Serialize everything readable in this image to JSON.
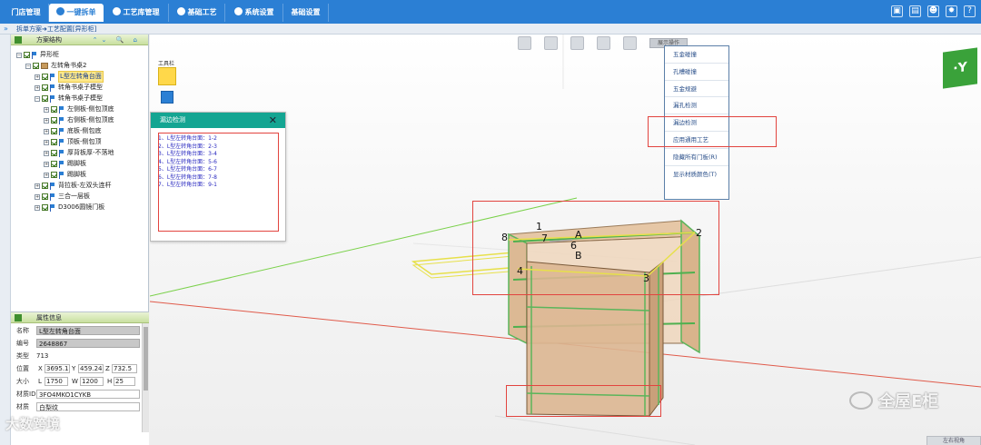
{
  "top_tabs": [
    {
      "label": "门店管理"
    },
    {
      "label": "一键拆单"
    },
    {
      "label": "工艺库管理"
    },
    {
      "label": "基础工艺"
    },
    {
      "label": "系统设置"
    },
    {
      "label": "基础设置"
    }
  ],
  "breadcrumb": {
    "arrow": "»",
    "text": "拆单方案➜工艺配置[异形柜]"
  },
  "scheme_panel": {
    "title": "方案结构",
    "tools": "⌃⌄ 🔍 ⌂",
    "tree": [
      {
        "label": "异形柜"
      },
      {
        "label": "左转角书桌2"
      },
      {
        "label": "L型左转角台面"
      },
      {
        "label": "转角书桌子模型"
      },
      {
        "label": "转角书桌子模型"
      },
      {
        "label": "左侧板-侧包顶底"
      },
      {
        "label": "右侧板-侧包顶底"
      },
      {
        "label": "底板-侧包底"
      },
      {
        "label": "顶板-侧包顶"
      },
      {
        "label": "厚背板厚-不落地"
      },
      {
        "label": "踢脚板"
      },
      {
        "label": "踢脚板"
      },
      {
        "label": "背拉板-左双头连杆"
      },
      {
        "label": "三合一层板"
      },
      {
        "label": "D3006圆镜门板"
      }
    ]
  },
  "props_panel": {
    "title": "属性信息",
    "name_label": "名称",
    "name_value": "L型左转角台面",
    "code_label": "编号",
    "code_value": "2648867",
    "type_label": "类型",
    "type_value": "713",
    "pos_label": "位置",
    "x_label": "X",
    "x_value": "3695.1",
    "y_label": "Y",
    "y_value": "459.24",
    "z_label": "Z",
    "z_value": "732.5",
    "size_label": "大小",
    "l_label": "L",
    "l_value": "1750",
    "w_label": "W",
    "w_value": "1200",
    "h_label": "H",
    "h_value": "25",
    "matid_label": "材质ID",
    "matid_value": "3FO4MKO1CYKB",
    "mat_label": "材质",
    "mat_value": "白梨纹"
  },
  "canvas": {
    "toolbox_label": "工具栏",
    "batch_button": "展示操作"
  },
  "dialog": {
    "title": "漏边检测",
    "items": [
      "1、L型左转角台面：1-2",
      "2、L型左转角台面：2-3",
      "3、L型左转角台面：3-4",
      "4、L型左转角台面：5-6",
      "5、L型左转角台面：6-7",
      "6、L型左转角台面：7-8",
      "7、L型左转角台面：9-1"
    ]
  },
  "context_menu": {
    "items": [
      "五金碰撞",
      "孔槽碰撞",
      "五金规避",
      "漏孔检测",
      "漏边检测",
      "应用通用工艺",
      "隐藏所有门板(R)",
      "显示材质颜色(T)"
    ]
  },
  "labels_3d": [
    "1",
    "2",
    "3",
    "4",
    "6",
    "7",
    "8",
    "A",
    "B"
  ],
  "watermark": {
    "brand": "全屋E柜",
    "bottom": "大数跨境"
  },
  "corner_button": "左右视角",
  "colors": {
    "tab_blue": "#2b7fd4",
    "dialog_teal": "#14a592",
    "highlight_red": "#e2443f",
    "cabinet_wood": "#e8c9a6",
    "logo_green": "#3aa23a"
  }
}
